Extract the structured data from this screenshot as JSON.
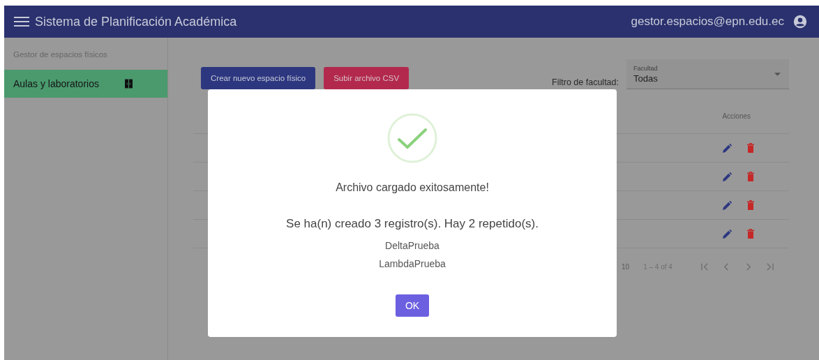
{
  "header": {
    "title": "Sistema de Planificación Académica",
    "user": "gestor.espacios@epn.edu.ec"
  },
  "sidebar": {
    "section": "Gestor de espacios físicos",
    "items": [
      {
        "label": "Aulas y laboratorios",
        "selected": true
      }
    ]
  },
  "toolbar": {
    "buttons": [
      {
        "label": "Crear nuevo espacio físico",
        "kind": "primary"
      },
      {
        "label": "Subir archivo CSV",
        "kind": "accent"
      }
    ],
    "filter_label": "Filtro de facultad:",
    "filter": {
      "label": "Facultad",
      "value": "Todas"
    }
  },
  "table": {
    "columns": [
      "Acciones"
    ],
    "rows": [
      {
        "kind": "actions"
      },
      {
        "kind": "actions"
      },
      {
        "kind": "actions"
      },
      {
        "kind": "actions"
      }
    ],
    "paginator": {
      "page_size": "10",
      "range": "1 – 4 of 4"
    }
  },
  "dialog": {
    "title": "Archivo cargado exitosamente!",
    "message": "Se ha(n) creado 3 registro(s). Hay 2 repetido(s).",
    "items": [
      "DeltaPrueba",
      "LambdaPrueba"
    ],
    "button": "OK"
  }
}
